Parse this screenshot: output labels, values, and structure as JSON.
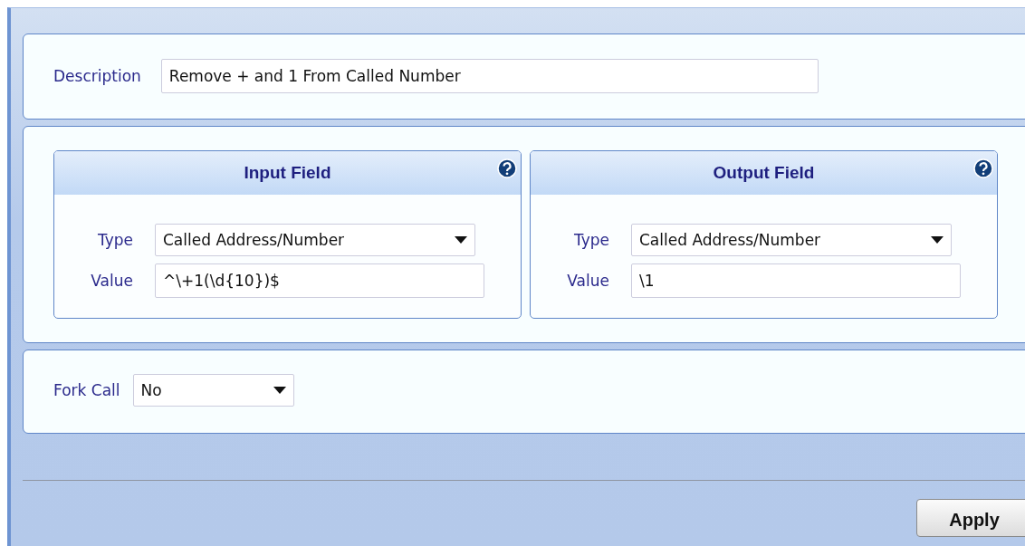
{
  "description": {
    "label": "Description",
    "value": "Remove + and 1 From Called Number"
  },
  "field_groups": [
    {
      "title": "Input Field",
      "type_label": "Type",
      "type_value": "Called Address/Number",
      "value_label": "Value",
      "value": "^\\+1(\\d{10})$"
    },
    {
      "title": "Output Field",
      "type_label": "Type",
      "type_value": "Called Address/Number",
      "value_label": "Value",
      "value": "\\1"
    }
  ],
  "fork_call": {
    "label": "Fork Call",
    "value": "No"
  },
  "apply_button": {
    "label": "Apply"
  }
}
